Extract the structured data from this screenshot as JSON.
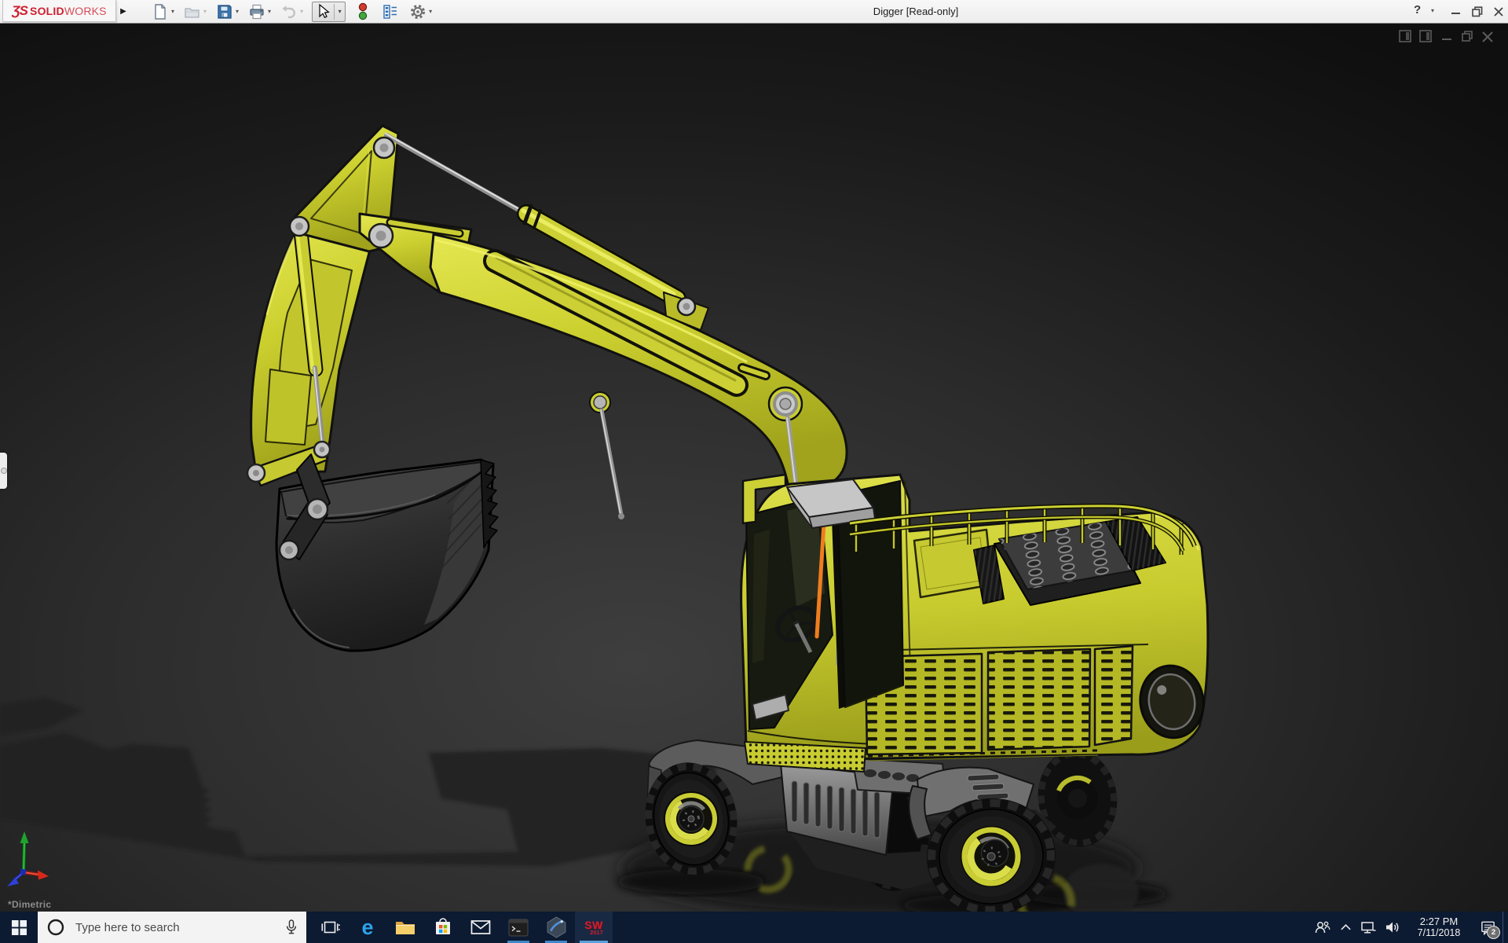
{
  "titlebar": {
    "brand": {
      "glyph": "ƷS",
      "solid": "SOLID",
      "works": "WORKS"
    },
    "title": "Digger [Read-only]",
    "help": "?",
    "flyout_arrow": "▶",
    "dropdown_arrow": "▾"
  },
  "toolbar": {
    "icons": [
      {
        "name": "new-document"
      },
      {
        "name": "open"
      },
      {
        "name": "save"
      },
      {
        "name": "print"
      },
      {
        "name": "undo"
      },
      {
        "name": "select-cursor"
      },
      {
        "name": "interference-stoplight"
      },
      {
        "name": "design-checklist"
      },
      {
        "name": "options-gear"
      }
    ]
  },
  "viewport": {
    "orientation_label": "*Dimetric",
    "model": "yellow wheeled excavator (Digger)"
  },
  "taskbar": {
    "search": {
      "placeholder": "Type here to search"
    },
    "apps": {
      "edge_glyph": "e",
      "solidworks_top": "SW",
      "solidworks_year": "2017"
    },
    "tray": {
      "time": "2:27 PM",
      "date": "7/11/2018",
      "badge": "2"
    }
  },
  "colors": {
    "machine_yellow": "#ccd02f",
    "taskbar_navy": "#0c1a32",
    "running_indicator": "#4a90d8",
    "brand_red": "#cf2030",
    "wiper_orange": "#ef7d1f",
    "axis_x_red": "#d8281a",
    "axis_y_green": "#1fa32c",
    "axis_z_blue": "#2d3fd4"
  }
}
